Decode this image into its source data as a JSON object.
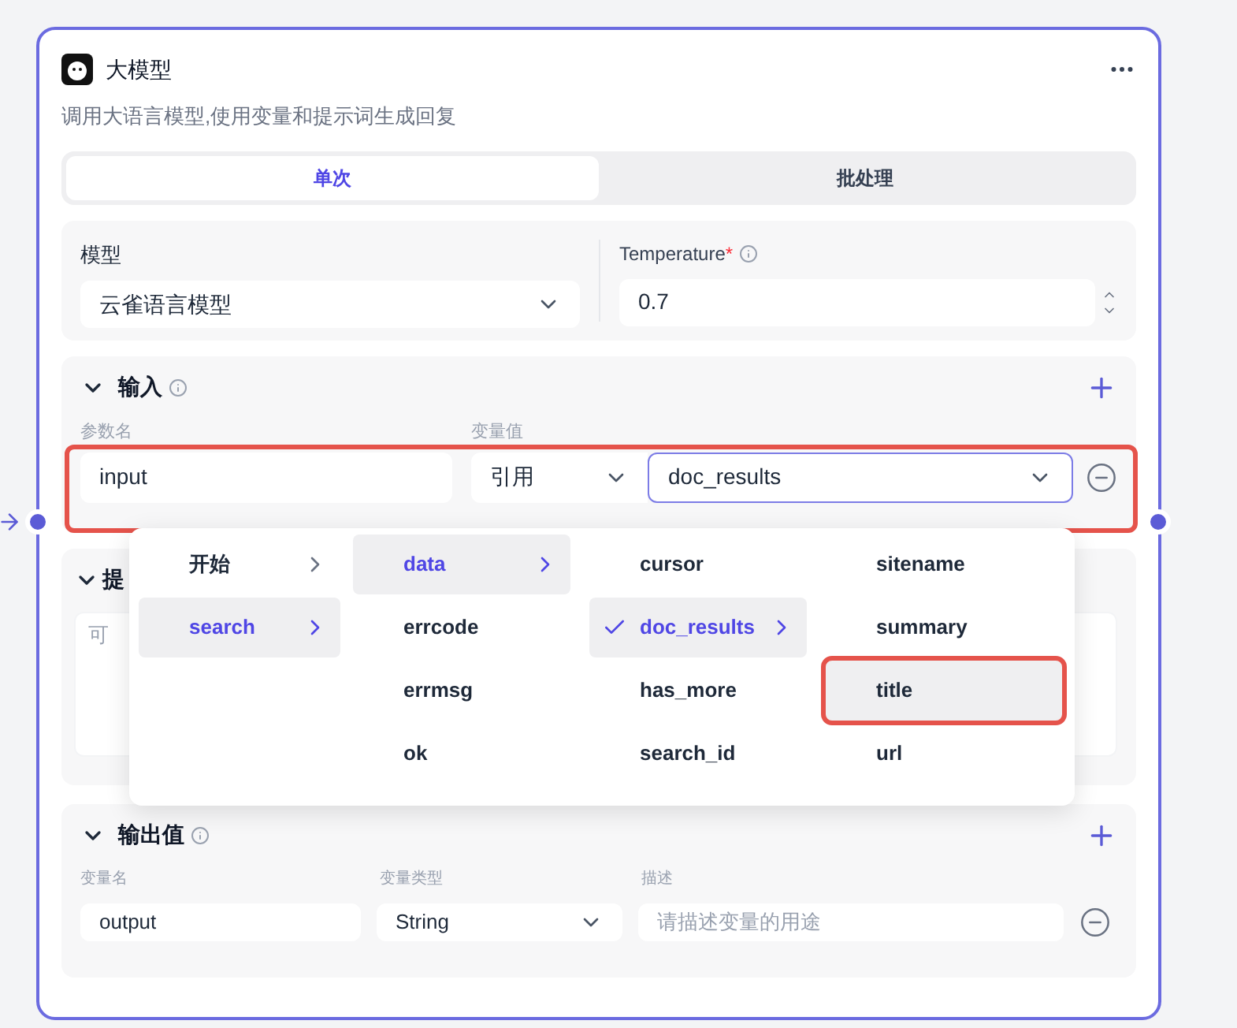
{
  "node": {
    "title": "大模型",
    "description": "调用大语言模型,使用变量和提示词生成回复"
  },
  "tabs": [
    {
      "label": "单次",
      "selected": true
    },
    {
      "label": "批处理",
      "selected": false
    }
  ],
  "model": {
    "label": "模型",
    "value": "云雀语言模型"
  },
  "temperature": {
    "label": "Temperature",
    "required_mark": "*",
    "value": "0.7"
  },
  "input_section": {
    "title": "输入",
    "expanded": true,
    "columns": [
      "参数名",
      "变量值"
    ],
    "row": {
      "name": "input",
      "source": "引用",
      "variable": "doc_results",
      "annotated": true
    }
  },
  "prompt_section": {
    "title": "提",
    "placeholder": "可",
    "expanded": true
  },
  "dropdown": {
    "columns": [
      [
        {
          "label": "开始",
          "selected": false,
          "checked": false,
          "has_children": true,
          "annotated": false
        },
        {
          "label": "search",
          "selected": true,
          "checked": false,
          "has_children": true,
          "annotated": false
        }
      ],
      [
        {
          "label": "data",
          "selected": true,
          "checked": false,
          "has_children": true,
          "annotated": false
        },
        {
          "label": "errcode",
          "selected": false,
          "checked": false,
          "has_children": false,
          "annotated": false
        },
        {
          "label": "errmsg",
          "selected": false,
          "checked": false,
          "has_children": false,
          "annotated": false
        },
        {
          "label": "ok",
          "selected": false,
          "checked": false,
          "has_children": false,
          "annotated": false
        }
      ],
      [
        {
          "label": "cursor",
          "selected": false,
          "checked": false,
          "has_children": false,
          "annotated": false
        },
        {
          "label": "doc_results",
          "selected": true,
          "checked": true,
          "has_children": true,
          "annotated": false
        },
        {
          "label": "has_more",
          "selected": false,
          "checked": false,
          "has_children": false,
          "annotated": false
        },
        {
          "label": "search_id",
          "selected": false,
          "checked": false,
          "has_children": false,
          "annotated": false
        }
      ],
      [
        {
          "label": "sitename",
          "selected": false,
          "checked": false,
          "has_children": false,
          "annotated": false
        },
        {
          "label": "summary",
          "selected": false,
          "checked": false,
          "has_children": false,
          "annotated": false
        },
        {
          "label": "title",
          "selected": false,
          "checked": false,
          "has_children": false,
          "annotated": true
        },
        {
          "label": "url",
          "selected": false,
          "checked": false,
          "has_children": false,
          "annotated": false
        }
      ]
    ]
  },
  "output_section": {
    "title": "输出值",
    "expanded": true,
    "columns": [
      "变量名",
      "变量类型",
      "描述"
    ],
    "row": {
      "name": "output",
      "type": "String",
      "placeholder": "请描述变量的用途"
    }
  }
}
